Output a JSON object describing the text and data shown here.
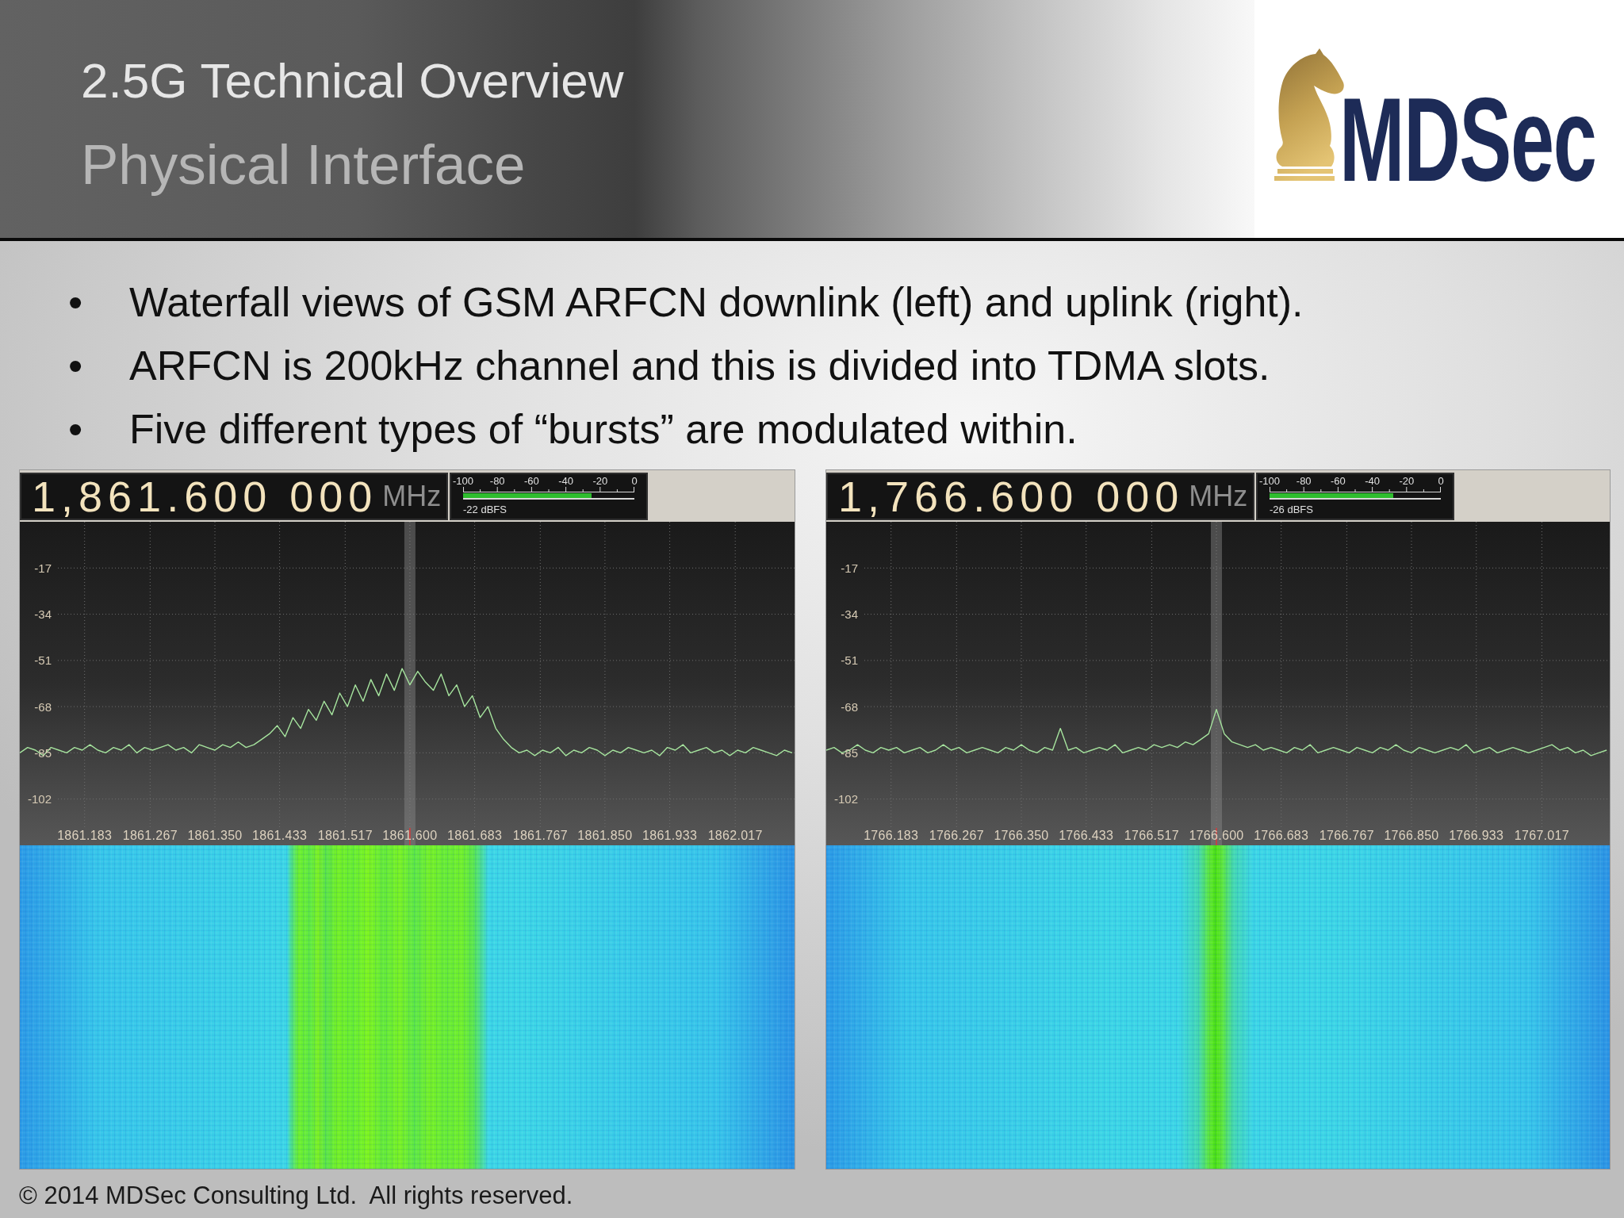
{
  "header": {
    "title": "2.5G Technical Overview",
    "subtitle": "Physical Interface",
    "logo": {
      "text": "MDSec"
    }
  },
  "bullets": [
    {
      "mark": "•",
      "text": "Waterfall views of GSM ARFCN downlink (left) and uplink (right)."
    },
    {
      "mark": "•",
      "text": "ARFCN is 200kHz channel and this is divided into TDMA slots."
    },
    {
      "mark": "•",
      "text": "Five different types of “bursts” are modulated within."
    }
  ],
  "panels": [
    {
      "kind": "wideband",
      "frequency": "1,861.600 000",
      "unit": "MHz",
      "meter": {
        "scale": [
          "-100",
          "-80",
          "-60",
          "-40",
          "-20",
          "0"
        ],
        "level": 0.75,
        "reading": "-22 dBFS"
      },
      "chart_data": {
        "type": "line",
        "grid": true,
        "color": "#a6e49e",
        "xlim": [
          1861.1,
          1862.093
        ],
        "ylim": [
          -119,
          0
        ],
        "yticks": [
          -17,
          -34,
          -51,
          -68,
          -85,
          -102
        ],
        "xticks": [
          {
            "value": 1861.183,
            "label": "1861.183"
          },
          {
            "value": 1861.267,
            "label": "1861.267"
          },
          {
            "value": 1861.35,
            "label": "1861.350"
          },
          {
            "value": 1861.433,
            "label": "1861.433"
          },
          {
            "value": 1861.517,
            "label": "1861.517"
          },
          {
            "value": 1861.6,
            "label": "1861.600"
          },
          {
            "value": 1861.683,
            "label": "1861.683"
          },
          {
            "value": 1861.767,
            "label": "1861.767"
          },
          {
            "value": 1861.85,
            "label": "1861.850"
          },
          {
            "value": 1861.933,
            "label": "1861.933"
          },
          {
            "value": 1862.017,
            "label": "1862.017"
          }
        ],
        "ref_lines": [
          {
            "axis": "x",
            "value": 1861.6,
            "color": "#8a8a8a"
          }
        ],
        "x": [
          1861.1,
          1861.11,
          1861.12,
          1861.13,
          1861.14,
          1861.15,
          1861.16,
          1861.17,
          1861.18,
          1861.19,
          1861.2,
          1861.21,
          1861.22,
          1861.23,
          1861.24,
          1861.25,
          1861.26,
          1861.27,
          1861.28,
          1861.29,
          1861.3,
          1861.31,
          1861.32,
          1861.33,
          1861.34,
          1861.35,
          1861.36,
          1861.37,
          1861.38,
          1861.39,
          1861.4,
          1861.41,
          1861.42,
          1861.43,
          1861.44,
          1861.45,
          1861.46,
          1861.47,
          1861.48,
          1861.49,
          1861.5,
          1861.51,
          1861.52,
          1861.53,
          1861.54,
          1861.55,
          1861.56,
          1861.57,
          1861.58,
          1861.59,
          1861.6,
          1861.61,
          1861.62,
          1861.63,
          1861.64,
          1861.65,
          1861.66,
          1861.67,
          1861.68,
          1861.69,
          1861.7,
          1861.71,
          1861.72,
          1861.73,
          1861.74,
          1861.75,
          1861.76,
          1861.77,
          1861.78,
          1861.79,
          1861.8,
          1861.81,
          1861.82,
          1861.83,
          1861.84,
          1861.85,
          1861.86,
          1861.87,
          1861.88,
          1861.89,
          1861.9,
          1861.91,
          1861.92,
          1861.93,
          1861.94,
          1861.95,
          1861.96,
          1861.97,
          1861.98,
          1861.99,
          1862,
          1862.01,
          1862.02,
          1862.03,
          1862.04,
          1862.05,
          1862.06,
          1862.07,
          1862.08,
          1862.09
        ],
        "values": [
          -85,
          -83,
          -84,
          -86,
          -83,
          -84,
          -85,
          -83,
          -84,
          -82,
          -84,
          -85,
          -83,
          -84,
          -82,
          -85,
          -83,
          -84,
          -83,
          -82,
          -84,
          -83,
          -85,
          -82,
          -83,
          -84,
          -82,
          -83,
          -81,
          -83,
          -82,
          -80,
          -78,
          -75,
          -79,
          -72,
          -76,
          -69,
          -73,
          -66,
          -71,
          -63,
          -68,
          -60,
          -66,
          -58,
          -64,
          -56,
          -62,
          -54,
          -60,
          -55,
          -59,
          -62,
          -56,
          -64,
          -60,
          -68,
          -64,
          -72,
          -68,
          -76,
          -80,
          -83,
          -85,
          -84,
          -86,
          -84,
          -85,
          -83,
          -86,
          -84,
          -85,
          -83,
          -84,
          -86,
          -84,
          -85,
          -83,
          -84,
          -85,
          -84,
          -86,
          -83,
          -84,
          -82,
          -85,
          -84,
          -83,
          -85,
          -84,
          -86,
          -84,
          -85,
          -83,
          -84,
          -85,
          -86,
          -84,
          -85
        ]
      }
    },
    {
      "kind": "narrowband",
      "frequency": "1,766.600 000",
      "unit": "MHz",
      "meter": {
        "scale": [
          "-100",
          "-80",
          "-60",
          "-40",
          "-20",
          "0"
        ],
        "level": 0.72,
        "reading": "-26 dBFS"
      },
      "chart_data": {
        "type": "line",
        "grid": true,
        "color": "#a6e49e",
        "xlim": [
          1766.1,
          1767.104
        ],
        "ylim": [
          -119,
          0
        ],
        "yticks": [
          -17,
          -34,
          -51,
          -68,
          -85,
          -102
        ],
        "xticks": [
          {
            "value": 1766.183,
            "label": "1766.183"
          },
          {
            "value": 1766.267,
            "label": "1766.267"
          },
          {
            "value": 1766.35,
            "label": "1766.350"
          },
          {
            "value": 1766.433,
            "label": "1766.433"
          },
          {
            "value": 1766.517,
            "label": "1766.517"
          },
          {
            "value": 1766.6,
            "label": "1766.600"
          },
          {
            "value": 1766.683,
            "label": "1766.683"
          },
          {
            "value": 1766.767,
            "label": "1766.767"
          },
          {
            "value": 1766.85,
            "label": "1766.850"
          },
          {
            "value": 1766.933,
            "label": "1766.933"
          },
          {
            "value": 1767.017,
            "label": "1767.017"
          }
        ],
        "ref_lines": [
          {
            "axis": "x",
            "value": 1766.6,
            "color": "#8a8a8a"
          }
        ],
        "x": [
          1766.1,
          1766.11,
          1766.12,
          1766.13,
          1766.14,
          1766.15,
          1766.16,
          1766.17,
          1766.18,
          1766.19,
          1766.2,
          1766.21,
          1766.22,
          1766.23,
          1766.24,
          1766.25,
          1766.26,
          1766.27,
          1766.28,
          1766.29,
          1766.3,
          1766.31,
          1766.32,
          1766.33,
          1766.34,
          1766.35,
          1766.36,
          1766.37,
          1766.38,
          1766.39,
          1766.4,
          1766.41,
          1766.42,
          1766.43,
          1766.44,
          1766.45,
          1766.46,
          1766.47,
          1766.48,
          1766.49,
          1766.5,
          1766.51,
          1766.52,
          1766.53,
          1766.54,
          1766.55,
          1766.56,
          1766.57,
          1766.58,
          1766.59,
          1766.6,
          1766.61,
          1766.62,
          1766.63,
          1766.64,
          1766.65,
          1766.66,
          1766.67,
          1766.68,
          1766.69,
          1766.7,
          1766.71,
          1766.72,
          1766.73,
          1766.74,
          1766.75,
          1766.76,
          1766.77,
          1766.78,
          1766.79,
          1766.8,
          1766.81,
          1766.82,
          1766.83,
          1766.84,
          1766.85,
          1766.86,
          1766.87,
          1766.88,
          1766.89,
          1766.9,
          1766.91,
          1766.92,
          1766.93,
          1766.94,
          1766.95,
          1766.96,
          1766.97,
          1766.98,
          1766.99,
          1767,
          1767.01,
          1767.02,
          1767.03,
          1767.04,
          1767.05,
          1767.06,
          1767.07,
          1767.08,
          1767.09,
          1767.1
        ],
        "values": [
          -84,
          -83,
          -85,
          -84,
          -82,
          -84,
          -85,
          -83,
          -84,
          -83,
          -85,
          -84,
          -83,
          -85,
          -84,
          -82,
          -84,
          -83,
          -85,
          -84,
          -83,
          -84,
          -85,
          -83,
          -84,
          -82,
          -84,
          -85,
          -83,
          -84,
          -76,
          -84,
          -83,
          -85,
          -84,
          -83,
          -84,
          -82,
          -85,
          -84,
          -83,
          -84,
          -82,
          -83,
          -82,
          -83,
          -81,
          -82,
          -80,
          -78,
          -69,
          -78,
          -81,
          -82,
          -83,
          -82,
          -84,
          -83,
          -84,
          -85,
          -83,
          -84,
          -82,
          -85,
          -84,
          -83,
          -84,
          -85,
          -83,
          -84,
          -85,
          -83,
          -84,
          -82,
          -84,
          -85,
          -83,
          -84,
          -85,
          -84,
          -83,
          -84,
          -82,
          -85,
          -84,
          -83,
          -85,
          -84,
          -83,
          -84,
          -85,
          -84,
          -83,
          -82,
          -84,
          -83,
          -85,
          -84,
          -86,
          -85,
          -84
        ]
      }
    }
  ],
  "footer": "© 2014 MDSec Consulting Ltd.  All rights reserved."
}
